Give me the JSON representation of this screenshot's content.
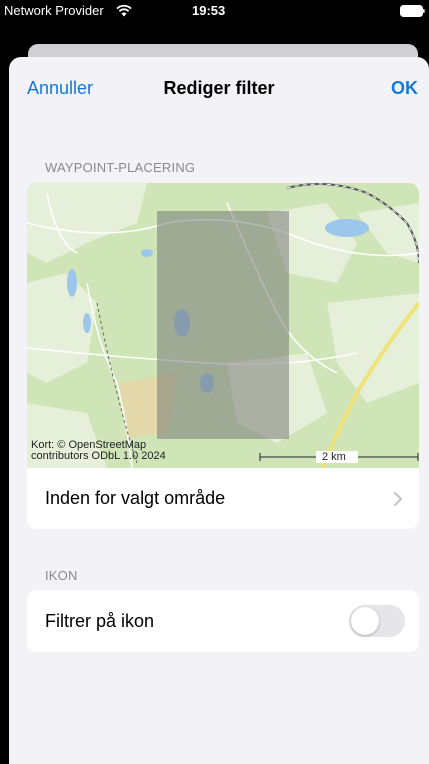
{
  "status_bar": {
    "carrier": "Network Provider",
    "time": "19:53"
  },
  "nav": {
    "cancel_label": "Annuller",
    "title": "Rediger filter",
    "ok_label": "OK"
  },
  "location_section": {
    "header": "WAYPOINT-PLACERING",
    "map": {
      "attribution_line1": "Kort: © OpenStreetMap",
      "attribution_line2": "contributors ODbL 1.0 2024",
      "scale_label": "2 km"
    },
    "row_label": "Inden for valgt område"
  },
  "icon_section": {
    "header": "IKON",
    "row_label": "Filtrer på ikon",
    "toggle_on": false
  },
  "colors": {
    "accent": "#1479d8",
    "background": "#f2f2f7"
  }
}
